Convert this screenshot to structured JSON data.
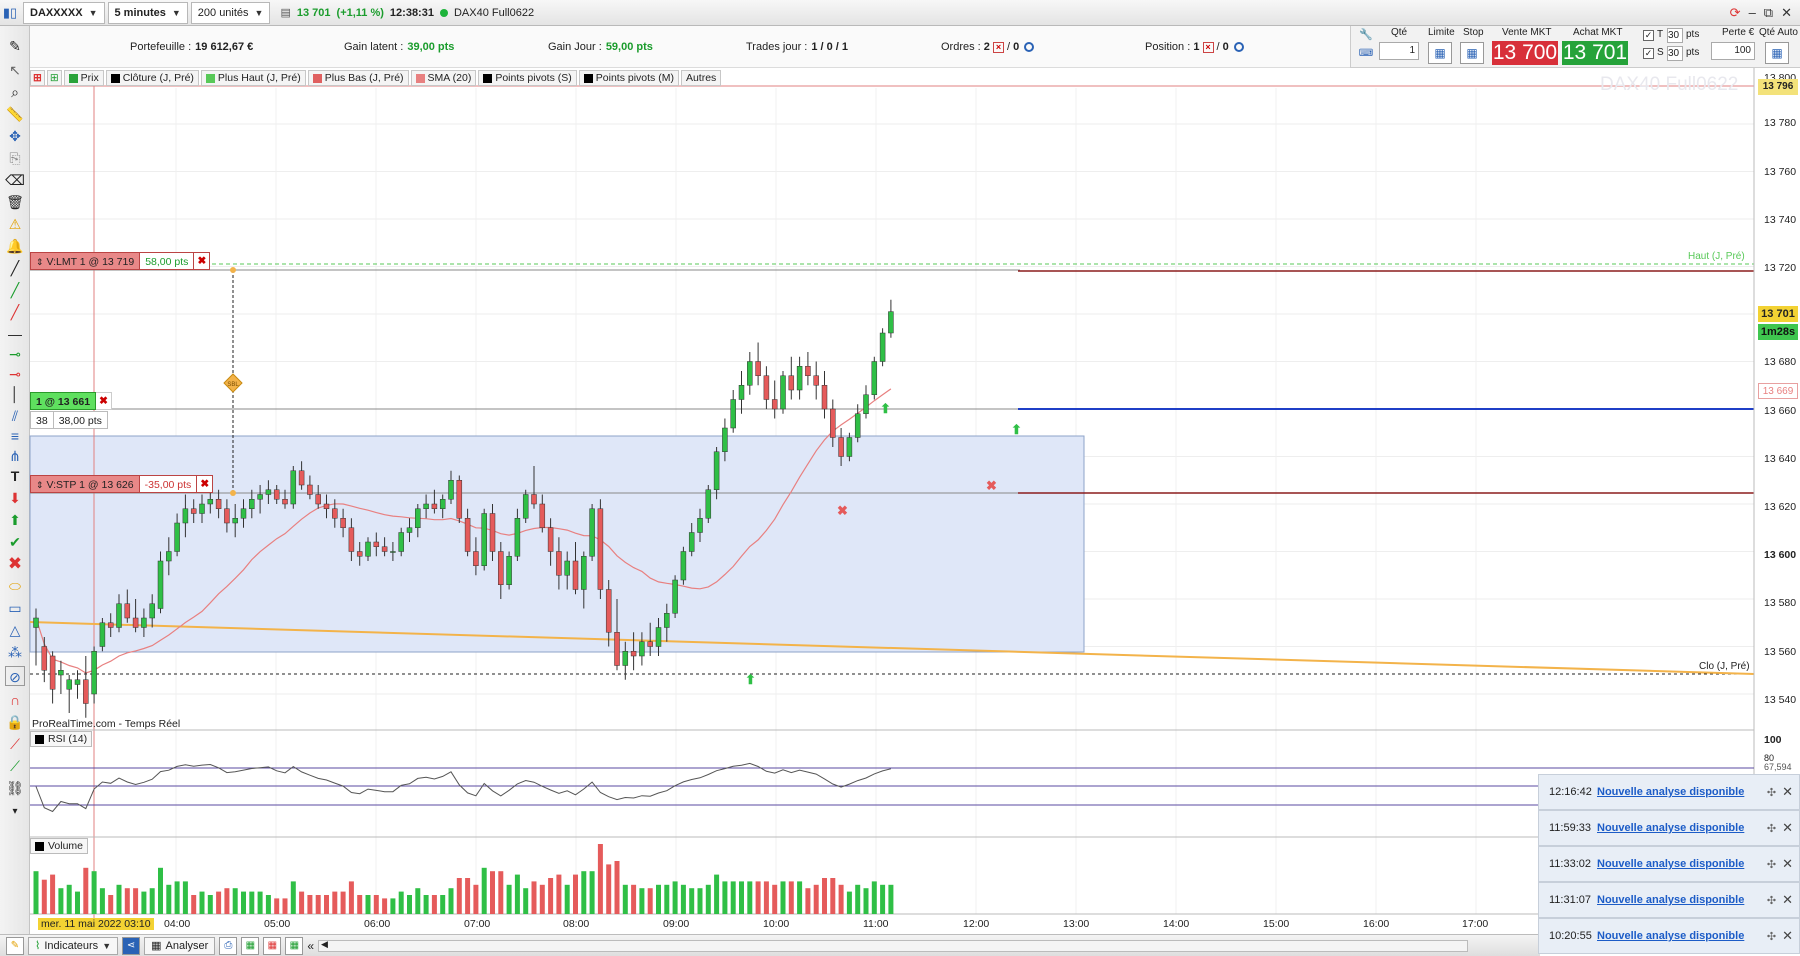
{
  "toolbar": {
    "symbol": "DAXXXXX",
    "timeframe": "5 minutes",
    "units": "200 unités",
    "last_price": "13 701",
    "change": "(+1,11 %)",
    "time": "12:38:31",
    "instrument": "DAX40 Full0622"
  },
  "info": {
    "portfolio_label": "Portefeuille :",
    "portfolio_value": "19 612,67 €",
    "latent_label": "Gain latent :",
    "latent_value": "39,00 pts",
    "day_gain_label": "Gain Jour :",
    "day_gain_value": "59,00 pts",
    "trades_label": "Trades jour :",
    "trades_value": "1 / 0 / 1",
    "orders_label": "Ordres :",
    "orders_value_a": "2",
    "orders_value_b": "0",
    "position_label": "Position :",
    "position_value_a": "1",
    "position_value_b": "0"
  },
  "order_panel": {
    "qty_label": "Qté",
    "qty_value": "1",
    "limit_label": "Limite",
    "stop_label": "Stop",
    "sell_label": "Vente MKT",
    "sell_price": "13 700",
    "buy_label": "Achat MKT",
    "buy_price": "13 701",
    "t_label": "T",
    "s_label": "S",
    "t_value": "30",
    "s_value": "30",
    "pts_label": "pts",
    "risk_label": "Perte €",
    "risk_value": "100",
    "auto_qty_label": "Qté Auto"
  },
  "legend": [
    {
      "label": "Prix",
      "color": "#2aa33a"
    },
    {
      "label": "Clôture (J, Pré)",
      "color": "#000000"
    },
    {
      "label": "Plus Haut (J, Pré)",
      "color": "#58c958"
    },
    {
      "label": "Plus Bas (J, Pré)",
      "color": "#e06060"
    },
    {
      "label": "SMA (20)",
      "color": "#e88080"
    },
    {
      "label": "Points pivots (S)",
      "color": "#000000"
    },
    {
      "label": "Points pivots (M)",
      "color": "#000000"
    },
    {
      "label": "Autres",
      "color": ""
    }
  ],
  "orders": {
    "limit_label": "V:LMT",
    "limit_detail": "1 @ 13 719",
    "limit_pts": "58,00 pts",
    "position_label": "1 @ 13 661",
    "position_qty": "38",
    "position_pts": "38,00 pts",
    "stop_label": "V:STP",
    "stop_detail": "1 @ 13 626",
    "stop_pts": "-35,00 pts"
  },
  "watermark": "DAX40 Full0622",
  "price_axis": [
    "13 800",
    "13 780",
    "13 760",
    "13 740",
    "13 720",
    "13 700",
    "13 680",
    "13 660",
    "13 640",
    "13 620",
    "13 600",
    "13 580",
    "13 560",
    "13 540"
  ],
  "price_tags": {
    "top": "13 796",
    "current": "13 701",
    "countdown": "1m28s",
    "sma": "13 669"
  },
  "annotations": {
    "high_prev": "Haut (J, Pré)",
    "close_prev": "Clo (J, Pré)",
    "source": "ProRealTime.com - Temps Réel",
    "pivot_mark": "SBL"
  },
  "rsi": {
    "label": "RSI (14)",
    "level_100": "100",
    "level_80": "80",
    "value": "67,594"
  },
  "volume": {
    "label": "Volume"
  },
  "time_axis": {
    "start": "mer. 11 mai 2022 03:10",
    "ticks": [
      "04:00",
      "05:00",
      "06:00",
      "07:00",
      "08:00",
      "09:00",
      "10:00",
      "11:00",
      "12:00",
      "13:00",
      "14:00",
      "15:00",
      "16:00",
      "17:00"
    ]
  },
  "bottom": {
    "indicators": "Indicateurs",
    "analyze": "Analyser"
  },
  "notifications": [
    {
      "time": "12:16:42",
      "text": "Nouvelle analyse disponible"
    },
    {
      "time": "11:59:33",
      "text": "Nouvelle analyse disponible"
    },
    {
      "time": "11:33:02",
      "text": "Nouvelle analyse disponible"
    },
    {
      "time": "11:31:07",
      "text": "Nouvelle analyse disponible"
    },
    {
      "time": "10:20:55",
      "text": "Nouvelle analyse disponible"
    }
  ],
  "colors": {
    "up": "#2fbf46",
    "down": "#e55b5b",
    "sma": "#e88080",
    "zone": "#dfe7f8",
    "trend": "#f3b34a",
    "position_line": "#1f3fc7",
    "stop_line": "#8c1d1d"
  },
  "chart_data": {
    "type": "candlestick",
    "series": [
      {
        "name": "DAX40",
        "ohlc": [
          [
            13568,
            13576,
            13552,
            13572
          ],
          [
            13560,
            13564,
            13545,
            13550
          ],
          [
            13556,
            13558,
            13536,
            13542
          ],
          [
            13548,
            13554,
            13540,
            13550
          ],
          [
            13542,
            13548,
            13532,
            13546
          ],
          [
            13544,
            13550,
            13538,
            13546
          ],
          [
            13546,
            13556,
            13530,
            13536
          ],
          [
            13540,
            13560,
            13536,
            13558
          ],
          [
            13560,
            13572,
            13558,
            13570
          ],
          [
            13570,
            13574,
            13564,
            13568
          ],
          [
            13568,
            13582,
            13566,
            13578
          ],
          [
            13578,
            13584,
            13570,
            13572
          ],
          [
            13572,
            13580,
            13566,
            13568
          ],
          [
            13568,
            13576,
            13564,
            13572
          ],
          [
            13572,
            13582,
            13568,
            13578
          ],
          [
            13576,
            13600,
            13574,
            13596
          ],
          [
            13596,
            13606,
            13590,
            13600
          ],
          [
            13600,
            13616,
            13598,
            13612
          ],
          [
            13612,
            13624,
            13606,
            13618
          ],
          [
            13618,
            13622,
            13612,
            13616
          ],
          [
            13616,
            13624,
            13612,
            13620
          ],
          [
            13620,
            13626,
            13616,
            13622
          ],
          [
            13622,
            13626,
            13614,
            13618
          ],
          [
            13618,
            13622,
            13608,
            13612
          ],
          [
            13612,
            13620,
            13606,
            13614
          ],
          [
            13614,
            13622,
            13610,
            13618
          ],
          [
            13618,
            13626,
            13614,
            13622
          ],
          [
            13622,
            13628,
            13616,
            13624
          ],
          [
            13624,
            13630,
            13620,
            13626
          ],
          [
            13626,
            13628,
            13620,
            13622
          ],
          [
            13622,
            13626,
            13618,
            13620
          ],
          [
            13620,
            13636,
            13618,
            13634
          ],
          [
            13634,
            13638,
            13626,
            13628
          ],
          [
            13628,
            13632,
            13622,
            13624
          ],
          [
            13624,
            13628,
            13618,
            13620
          ],
          [
            13620,
            13624,
            13614,
            13618
          ],
          [
            13618,
            13622,
            13610,
            13614
          ],
          [
            13614,
            13618,
            13606,
            13610
          ],
          [
            13610,
            13614,
            13596,
            13600
          ],
          [
            13600,
            13604,
            13594,
            13598
          ],
          [
            13598,
            13606,
            13596,
            13604
          ],
          [
            13604,
            13608,
            13598,
            13602
          ],
          [
            13602,
            13606,
            13598,
            13600
          ],
          [
            13600,
            13604,
            13596,
            13600
          ],
          [
            13600,
            13610,
            13598,
            13608
          ],
          [
            13608,
            13614,
            13604,
            13610
          ],
          [
            13610,
            13620,
            13606,
            13618
          ],
          [
            13618,
            13624,
            13614,
            13620
          ],
          [
            13620,
            13626,
            13616,
            13618
          ],
          [
            13618,
            13624,
            13614,
            13622
          ],
          [
            13622,
            13634,
            13620,
            13630
          ],
          [
            13630,
            13632,
            13612,
            13614
          ],
          [
            13614,
            13618,
            13598,
            13600
          ],
          [
            13600,
            13606,
            13590,
            13594
          ],
          [
            13594,
            13618,
            13592,
            13616
          ],
          [
            13616,
            13620,
            13596,
            13600
          ],
          [
            13600,
            13604,
            13580,
            13586
          ],
          [
            13586,
            13600,
            13584,
            13598
          ],
          [
            13598,
            13618,
            13596,
            13614
          ],
          [
            13614,
            13626,
            13612,
            13624
          ],
          [
            13624,
            13636,
            13618,
            13620
          ],
          [
            13620,
            13624,
            13608,
            13610
          ],
          [
            13610,
            13614,
            13594,
            13600
          ],
          [
            13600,
            13606,
            13584,
            13590
          ],
          [
            13590,
            13600,
            13584,
            13596
          ],
          [
            13596,
            13604,
            13582,
            13584
          ],
          [
            13584,
            13600,
            13576,
            13598
          ],
          [
            13598,
            13620,
            13596,
            13618
          ],
          [
            13618,
            13622,
            13580,
            13584
          ],
          [
            13584,
            13588,
            13560,
            13566
          ],
          [
            13566,
            13580,
            13550,
            13552
          ],
          [
            13552,
            13562,
            13546,
            13558
          ],
          [
            13558,
            13566,
            13550,
            13556
          ],
          [
            13556,
            13566,
            13552,
            13562
          ],
          [
            13562,
            13570,
            13556,
            13560
          ],
          [
            13560,
            13572,
            13556,
            13568
          ],
          [
            13568,
            13578,
            13562,
            13574
          ],
          [
            13574,
            13590,
            13572,
            13588
          ],
          [
            13588,
            13602,
            13586,
            13600
          ],
          [
            13600,
            13612,
            13598,
            13608
          ],
          [
            13608,
            13618,
            13604,
            13614
          ],
          [
            13614,
            13628,
            13612,
            13626
          ],
          [
            13626,
            13644,
            13622,
            13642
          ],
          [
            13642,
            13656,
            13638,
            13652
          ],
          [
            13652,
            13668,
            13650,
            13664
          ],
          [
            13664,
            13676,
            13658,
            13670
          ],
          [
            13670,
            13684,
            13666,
            13680
          ],
          [
            13680,
            13688,
            13670,
            13674
          ],
          [
            13674,
            13678,
            13660,
            13664
          ],
          [
            13664,
            13672,
            13656,
            13660
          ],
          [
            13660,
            13676,
            13658,
            13674
          ],
          [
            13674,
            13682,
            13664,
            13668
          ],
          [
            13668,
            13682,
            13664,
            13678
          ],
          [
            13678,
            13684,
            13670,
            13674
          ],
          [
            13674,
            13680,
            13664,
            13670
          ],
          [
            13670,
            13676,
            13656,
            13660
          ],
          [
            13660,
            13664,
            13644,
            13648
          ],
          [
            13648,
            13652,
            13636,
            13640
          ],
          [
            13640,
            13650,
            13638,
            13648
          ],
          [
            13648,
            13662,
            13646,
            13658
          ],
          [
            13658,
            13670,
            13656,
            13666
          ],
          [
            13666,
            13682,
            13664,
            13680
          ],
          [
            13680,
            13694,
            13678,
            13692
          ],
          [
            13692,
            13706,
            13690,
            13701
          ]
        ]
      },
      {
        "name": "SMA (20)",
        "start": 13580,
        "end": 13669
      }
    ],
    "ylim": [
      13530,
      13800
    ],
    "levels": {
      "high_prev": 13722,
      "close_prev": 13550,
      "limit": 13719,
      "position": 13661,
      "stop": 13626
    }
  }
}
